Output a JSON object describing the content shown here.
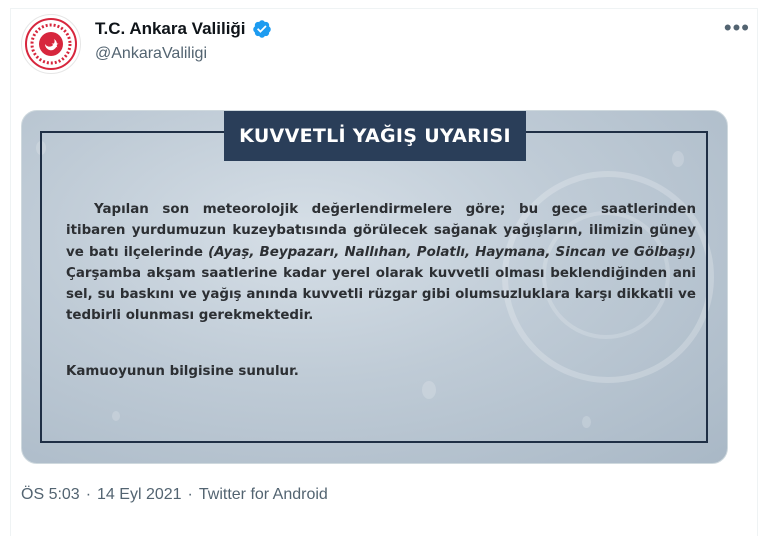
{
  "account": {
    "name": "T.C. Ankara Valiliği",
    "handle": "@AnkaraValiligi",
    "verified": true,
    "avatar_icon": "ankara-governorship-seal"
  },
  "more_icon": "•••",
  "media": {
    "title": "KUVVETLİ YAĞIŞ UYARISI",
    "text_before": "Yapılan son meteorolojik değerlendirmelere göre; bu gece saatlerinden itibaren yurdumuzun kuzeybatısında görülecek sağanak yağışların, ilimizin güney ve batı ilçelerinde ",
    "districts": "(Ayaş, Beypazarı, Nallıhan, Polatlı, Haymana, Sincan ve Gölbaşı)",
    "text_after": " Çarşamba akşam saatlerine kadar yerel olarak kuvvetli olması beklendiğinden ani sel, su baskını ve yağış anında kuvvetli rüzgar gibi olumsuzluklara karşı dikkatli ve tedbirli olunması gerekmektedir.",
    "footer": "Kamuoyunun bilgisine sunulur.",
    "colors": {
      "title_bg": "#2a3e59",
      "border": "#1f2f45"
    }
  },
  "meta": {
    "time": "ÖS 5:03",
    "separator": "·",
    "date": "14 Eyl 2021",
    "source": "Twitter for Android"
  },
  "colors": {
    "verified": "#1d9bf0",
    "secondary_text": "#536471"
  }
}
